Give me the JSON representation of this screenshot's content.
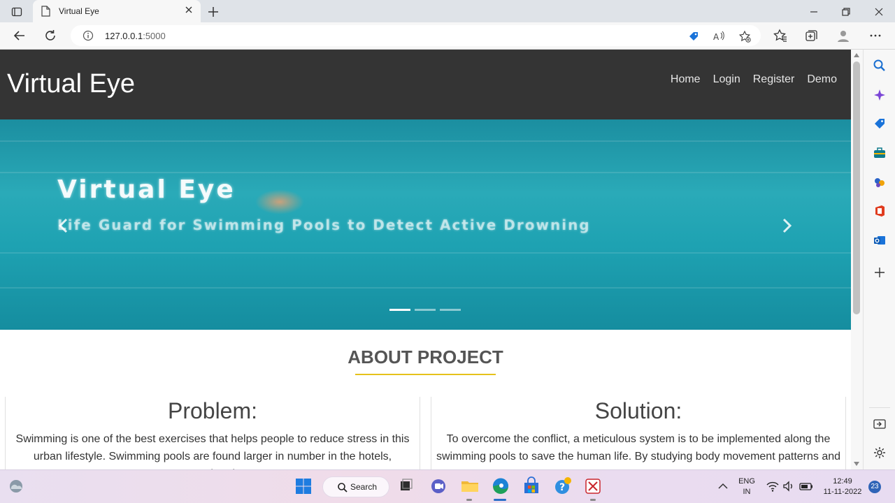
{
  "browser": {
    "tab": {
      "title": "Virtual Eye"
    },
    "address": {
      "host": "127.0.0.1",
      "port": ":5000"
    }
  },
  "site": {
    "logo": "Virtual Eye",
    "nav": [
      "Home",
      "Login",
      "Register",
      "Demo"
    ],
    "hero": {
      "title": "Virtual Eye",
      "subtitle": "Life Guard for Swimming Pools to Detect Active Drowning",
      "slide_count": 3,
      "active_slide": 1
    },
    "about": {
      "heading": "ABOUT PROJECT",
      "accent_color": "#e6c21b",
      "problem": {
        "title": "Problem:",
        "text": "Swimming is one of the best exercises that helps people to reduce stress in this urban lifestyle. Swimming pools are found larger in number in the hotels, weekend"
      },
      "solution": {
        "title": "Solution:",
        "text": "To overcome the conflict, a meticulous system is to be implemented along the swimming pools to save the human life. By studying body movement patterns and"
      }
    }
  },
  "taskbar": {
    "search_label": "Search",
    "lang_primary": "ENG",
    "lang_secondary": "IN",
    "time": "12:49",
    "date": "11-11-2022",
    "notification_count": "23"
  }
}
